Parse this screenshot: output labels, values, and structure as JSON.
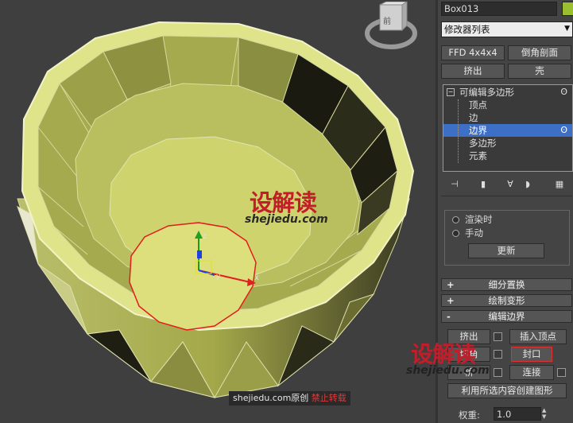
{
  "viewport": {
    "gizmo_axes": {
      "x": "x",
      "y": "y",
      "z": "z"
    },
    "viewcube_label": "前"
  },
  "watermarks": {
    "center_logo": "设解读",
    "center_url": "shejiedu.com",
    "right_logo": "设解读",
    "right_url": "shejiedu.com",
    "footer_site": "shejiedu.com",
    "footer_original": "原创",
    "footer_notice": "禁止转载"
  },
  "panel": {
    "object_name": "Box013",
    "object_color": "#9bbf2e",
    "modifier_list": "修改器列表",
    "quick_buttons": [
      "FFD 4x4x4",
      "倒角剖面",
      "挤出",
      "壳"
    ],
    "stack": {
      "root": "可编辑多边形",
      "items": [
        "顶点",
        "边",
        "边界",
        "多边形",
        "元素"
      ],
      "selected_index": 2
    },
    "render_options": {
      "on_render": "渲染时",
      "manual": "手动",
      "update_button": "更新"
    },
    "rollouts": {
      "subdivision_displacement": "细分置换",
      "paint_deformation": "绘制变形",
      "edit_borders": "编辑边界"
    },
    "edit_borders": {
      "extrude": "挤出",
      "insert_vertex": "插入顶点",
      "chamfer": "切角",
      "cap": "封口",
      "bridge": "桥",
      "connect": "连接",
      "create_shape": "利用所选内容创建图形",
      "weight_label": "权重:",
      "weight_value": "1.0"
    }
  }
}
